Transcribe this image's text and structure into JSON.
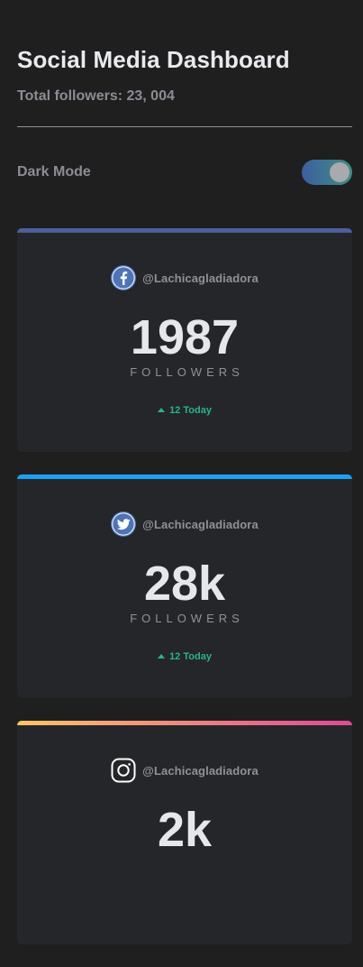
{
  "header": {
    "title": "Social Media Dashboard",
    "total_followers": "Total followers: 23, 004"
  },
  "theme": {
    "label": "Dark Mode",
    "state": "on"
  },
  "cards": [
    {
      "network": "facebook",
      "icon": "facebook-icon",
      "accent": "#4b5f9a",
      "handle": "@Lachicagladiadora",
      "count": "1987",
      "unit": "FOLLOWERS",
      "today": "12 Today"
    },
    {
      "network": "twitter",
      "icon": "twitter-icon",
      "accent": "#1ca0f2",
      "handle": "@Lachicagladiadora",
      "count": "28k",
      "unit": "FOLLOWERS",
      "today": "12 Today"
    },
    {
      "network": "instagram",
      "icon": "instagram-icon",
      "accent": "#fdc468",
      "accent_end": "#df4996",
      "handle": "@Lachicagladiadora",
      "count": "2k"
    }
  ],
  "colors": {
    "background": "#1f1f20",
    "card": "#252629",
    "positive": "#28b38f",
    "toggle_start": "#3d5ea0",
    "toggle_end": "#3f8f84"
  }
}
